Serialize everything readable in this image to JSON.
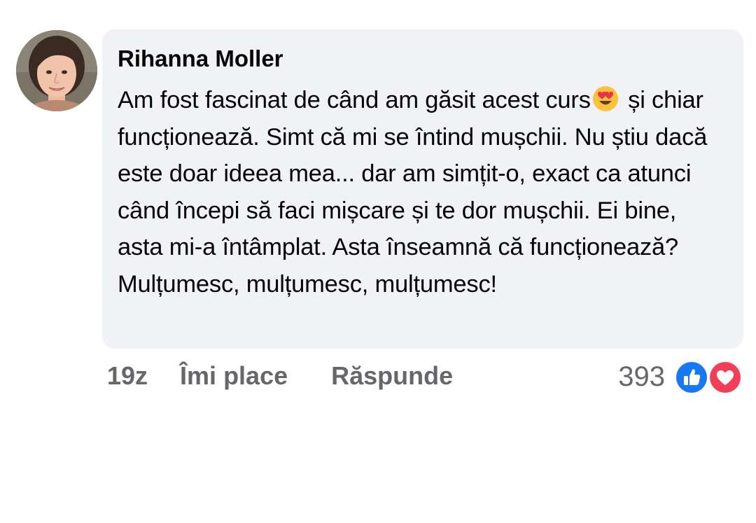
{
  "comment": {
    "author": "Rihanna Moller",
    "text_before_emoji": "Am fost fascinat de când am găsit acest curs",
    "emoji": "smiling-face-with-heart-eyes-emoji",
    "text_after_emoji": " și chiar funcționează. Simt că mi se întind mușchii. Nu știu dacă este doar ideea mea... dar am simțit-o, exact ca atunci când începi să faci mișcare și te dor mușchii. Ei bine, asta mi-a întâmplat. Asta înseamnă că funcționează? Mulțumesc, mulțumesc, mulțumesc!"
  },
  "actions": {
    "timestamp": "19z",
    "like_label": "Îmi place",
    "reply_label": "Răspunde"
  },
  "reactions": {
    "count": "393",
    "icons": [
      "like-icon",
      "heart-icon"
    ],
    "like_color": "#1877f2",
    "heart_color": "#f33e58"
  },
  "colors": {
    "bubble_background": "#f0f2f5",
    "text": "#050505",
    "secondary_text": "#65676b"
  }
}
